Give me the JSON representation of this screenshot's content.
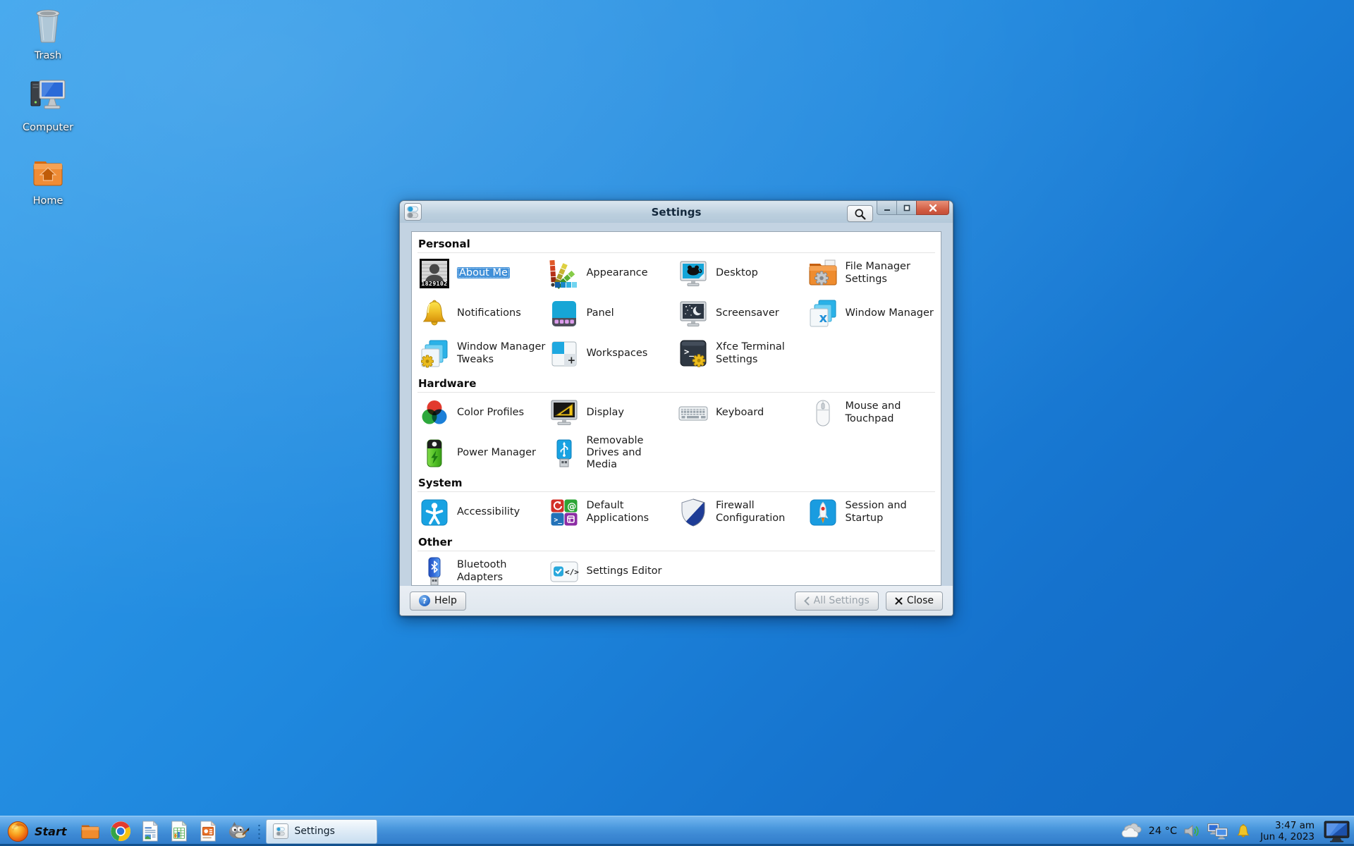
{
  "desktop": {
    "icons": [
      {
        "label": "Trash"
      },
      {
        "label": "Computer"
      },
      {
        "label": "Home"
      }
    ]
  },
  "window": {
    "title": "Settings",
    "sections": [
      {
        "title": "Personal",
        "items": [
          {
            "label": "About Me",
            "selected": true,
            "badge": "1829102"
          },
          {
            "label": "Appearance"
          },
          {
            "label": "Desktop"
          },
          {
            "label": "File Manager Settings"
          },
          {
            "label": "Notifications"
          },
          {
            "label": "Panel"
          },
          {
            "label": "Screensaver"
          },
          {
            "label": "Window Manager"
          },
          {
            "label": "Window Manager Tweaks"
          },
          {
            "label": "Workspaces"
          },
          {
            "label": "Xfce Terminal Settings"
          }
        ]
      },
      {
        "title": "Hardware",
        "items": [
          {
            "label": "Color Profiles"
          },
          {
            "label": "Display"
          },
          {
            "label": "Keyboard"
          },
          {
            "label": "Mouse and Touchpad"
          },
          {
            "label": "Power Manager"
          },
          {
            "label": "Removable Drives and Media"
          }
        ]
      },
      {
        "title": "System",
        "items": [
          {
            "label": "Accessibility"
          },
          {
            "label": "Default Applications"
          },
          {
            "label": "Firewall Configuration"
          },
          {
            "label": "Session and Startup"
          }
        ]
      },
      {
        "title": "Other",
        "items": [
          {
            "label": "Bluetooth Adapters"
          },
          {
            "label": "Settings Editor"
          }
        ]
      }
    ],
    "footer": {
      "help": "Help",
      "all_settings": "All Settings",
      "close": "Close"
    }
  },
  "icon_glyphs": {
    "wm_x": "x",
    "plus": "+",
    "prompt": ">_",
    "at": "@",
    "code": "</>",
    "help": "?"
  },
  "taskbar": {
    "start": "Start",
    "task": "Settings",
    "tray": {
      "temperature": "24 °C"
    },
    "clock": {
      "time": "3:47 am",
      "date": "Jun 4, 2023"
    }
  },
  "accent_colors": {
    "selection": "#3f8fd8",
    "taskbar_blue": "#3d89d4",
    "close_red": "#d05a41"
  }
}
